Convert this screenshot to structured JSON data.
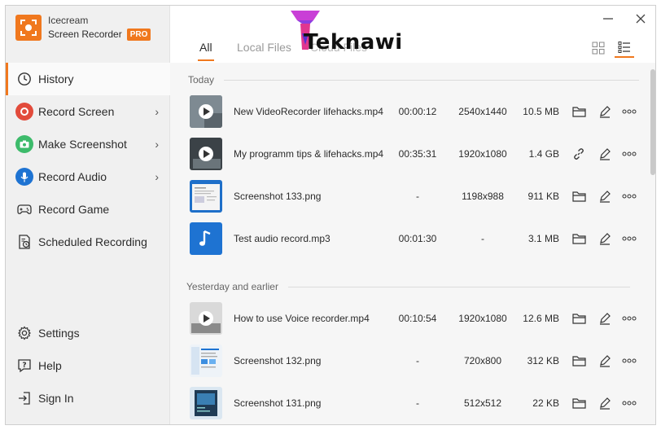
{
  "app": {
    "name": "Icecream",
    "product": "Screen Recorder",
    "badge": "PRO"
  },
  "watermark": {
    "text": "Teknawi"
  },
  "sidebar": {
    "items": [
      {
        "label": "History",
        "icon": "clock-icon",
        "active": true
      },
      {
        "label": "Record Screen",
        "icon": "record-icon",
        "color": "#e24b3b",
        "submenu": true
      },
      {
        "label": "Make Screenshot",
        "icon": "camera-icon",
        "color": "#3dbb6b",
        "submenu": true
      },
      {
        "label": "Record Audio",
        "icon": "microphone-icon",
        "color": "#1e73d2",
        "submenu": true
      },
      {
        "label": "Record Game",
        "icon": "gamepad-icon"
      },
      {
        "label": "Scheduled Recording",
        "icon": "schedule-icon"
      }
    ],
    "bottom": [
      {
        "label": "Settings",
        "icon": "gear-icon"
      },
      {
        "label": "Help",
        "icon": "help-icon"
      },
      {
        "label": "Sign In",
        "icon": "sign-in-icon"
      }
    ]
  },
  "tabs": [
    {
      "label": "All",
      "active": true
    },
    {
      "label": "Local Files"
    },
    {
      "label": "Cloud Files"
    }
  ],
  "accent": "#f0781e",
  "sections": [
    {
      "title": "Today",
      "rows": [
        {
          "name": "New VideoRecorder lifehacks.mp4",
          "duration": "00:00:12",
          "resolution": "2540x1440",
          "size": "10.5 MB",
          "thumb": "video",
          "action1": "folder-icon"
        },
        {
          "name": "My programm tips & lifehacks.mp4",
          "duration": "00:35:31",
          "resolution": "1920x1080",
          "size": "1.4 GB",
          "thumb": "video-dark",
          "action1": "link-icon"
        },
        {
          "name": "Screenshot 133.png",
          "duration": "-",
          "resolution": "1198x988",
          "size": "911 KB",
          "thumb": "screenshot",
          "action1": "folder-icon"
        },
        {
          "name": "Test audio record.mp3",
          "duration": "00:01:30",
          "resolution": "-",
          "size": "3.1 MB",
          "thumb": "audio",
          "action1": "folder-icon"
        }
      ]
    },
    {
      "title": "Yesterday and earlier",
      "rows": [
        {
          "name": "How to use Voice recorder.mp4",
          "duration": "00:10:54",
          "resolution": "1920x1080",
          "size": "12.6 MB",
          "thumb": "video",
          "action1": "folder-icon"
        },
        {
          "name": "Screenshot 132.png",
          "duration": "-",
          "resolution": "720x800",
          "size": "312 KB",
          "thumb": "screenshot",
          "action1": "folder-icon"
        },
        {
          "name": "Screenshot 131.png",
          "duration": "-",
          "resolution": "512x512",
          "size": "22 KB",
          "thumb": "screenshot-dark",
          "action1": "folder-icon"
        }
      ]
    }
  ]
}
